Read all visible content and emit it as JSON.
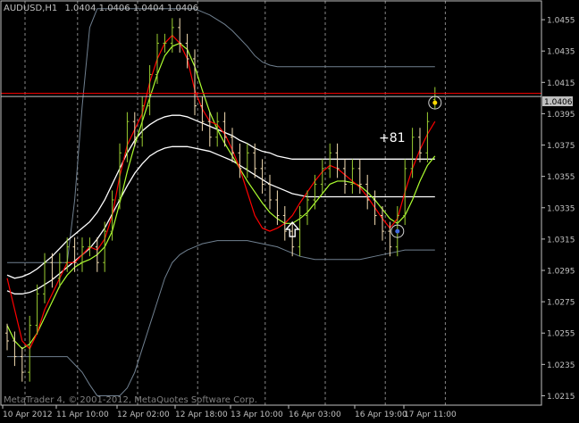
{
  "header": {
    "symbol_timeframe": "AUDUSD,H1",
    "ohlc": "1.0404 1.0406 1.0404 1.0406"
  },
  "current_price_label": "1.0406",
  "profit_annotation": "+81",
  "watermark": "MetaTrader 4, © 2001-2012, MetaQuotes Software Corp.",
  "colors": {
    "background": "#000000",
    "frame": "#c0c0c0",
    "grid": "#c0c0c0",
    "text": "#c0c0c0",
    "bull_candle": "#9acd32",
    "bear_candle": "#f5deb3",
    "ma_fast": "#ff0000",
    "ma_slow": "#adff2f",
    "envelope": "#ffffff",
    "bollinger": "#708090",
    "price_line": "#ff0000",
    "bid_line": "#c0c0c0"
  },
  "icons": [
    "up-arrow-icon",
    "entry-circle-icon",
    "exit-circle-icon"
  ],
  "chart_data": {
    "type": "candlestick",
    "symbol": "AUDUSD",
    "timeframe": "H1",
    "y_ticks": [
      "1.0455",
      "1.0435",
      "1.0415",
      "1.0395",
      "1.0375",
      "1.0355",
      "1.0335",
      "1.0315",
      "1.0295",
      "1.0275",
      "1.0255",
      "1.0235",
      "1.0215"
    ],
    "ylim": [
      1.0209,
      1.0467
    ],
    "x_ticks": [
      "10 Apr 2012",
      "11 Apr 10:00",
      "12 Apr 02:00",
      "12 Apr 18:00",
      "13 Apr 10:00",
      "16 Apr 03:00",
      "16 Apr 19:00",
      "17 Apr 11:00"
    ],
    "horizontal_lines": [
      {
        "name": "red-level",
        "value": 1.0408
      },
      {
        "name": "bid-level",
        "value": 1.0406
      }
    ],
    "close": [
      1.025,
      1.024,
      1.023,
      1.026,
      1.028,
      1.03,
      1.029,
      1.03,
      1.031,
      1.03,
      1.031,
      1.031,
      1.03,
      1.032,
      1.034,
      1.037,
      1.039,
      1.038,
      1.04,
      1.042,
      1.044,
      1.044,
      1.045,
      1.044,
      1.043,
      1.04,
      1.039,
      1.038,
      1.039,
      1.038,
      1.037,
      1.036,
      1.037,
      1.036,
      1.035,
      1.034,
      1.033,
      1.032,
      1.031,
      1.033,
      1.034,
      1.035,
      1.036,
      1.037,
      1.036,
      1.035,
      1.036,
      1.035,
      1.034,
      1.033,
      1.032,
      1.031,
      1.033,
      1.036,
      1.038,
      1.037,
      1.039,
      1.0406
    ],
    "open": [
      1.0255,
      1.025,
      1.024,
      1.023,
      1.026,
      1.028,
      1.03,
      1.029,
      1.03,
      1.031,
      1.03,
      1.031,
      1.031,
      1.03,
      1.032,
      1.034,
      1.037,
      1.039,
      1.038,
      1.04,
      1.042,
      1.044,
      1.044,
      1.045,
      1.044,
      1.043,
      1.04,
      1.039,
      1.038,
      1.039,
      1.038,
      1.037,
      1.036,
      1.037,
      1.036,
      1.035,
      1.034,
      1.033,
      1.032,
      1.031,
      1.033,
      1.034,
      1.035,
      1.036,
      1.037,
      1.036,
      1.035,
      1.036,
      1.035,
      1.034,
      1.033,
      1.032,
      1.031,
      1.033,
      1.036,
      1.038,
      1.037,
      1.0404
    ],
    "ma_fast": [
      1.029,
      1.027,
      1.025,
      1.0245,
      1.0255,
      1.027,
      1.028,
      1.029,
      1.03,
      1.03,
      1.0305,
      1.031,
      1.0308,
      1.0315,
      1.033,
      1.0355,
      1.0375,
      1.0385,
      1.0395,
      1.0415,
      1.043,
      1.044,
      1.0445,
      1.044,
      1.043,
      1.041,
      1.0398,
      1.039,
      1.0388,
      1.0382,
      1.0372,
      1.036,
      1.0345,
      1.033,
      1.0322,
      1.032,
      1.0322,
      1.0325,
      1.033,
      1.0338,
      1.0345,
      1.0352,
      1.0358,
      1.0362,
      1.036,
      1.0356,
      1.0352,
      1.0348,
      1.0342,
      1.0335,
      1.0328,
      1.0322,
      1.0328,
      1.0345,
      1.036,
      1.0372,
      1.0382,
      1.039
    ],
    "ma_slow": [
      1.026,
      1.025,
      1.0245,
      1.0248,
      1.0255,
      1.0265,
      1.0275,
      1.0285,
      1.0292,
      1.0297,
      1.03,
      1.0302,
      1.0305,
      1.031,
      1.032,
      1.0338,
      1.0358,
      1.0375,
      1.039,
      1.0405,
      1.042,
      1.0432,
      1.0438,
      1.044,
      1.0436,
      1.0425,
      1.041,
      1.0396,
      1.0385,
      1.0376,
      1.0368,
      1.036,
      1.0352,
      1.0345,
      1.0338,
      1.0332,
      1.0328,
      1.0325,
      1.0325,
      1.0328,
      1.0332,
      1.0338,
      1.0344,
      1.035,
      1.0352,
      1.0352,
      1.0351,
      1.0349,
      1.0345,
      1.034,
      1.0334,
      1.0328,
      1.0325,
      1.033,
      1.034,
      1.0352,
      1.0362,
      1.0368
    ],
    "envelope_upper": [
      1.0292,
      1.029,
      1.0291,
      1.0293,
      1.0296,
      1.03,
      1.0304,
      1.0309,
      1.0314,
      1.0318,
      1.0322,
      1.0326,
      1.0332,
      1.034,
      1.035,
      1.036,
      1.037,
      1.0378,
      1.0384,
      1.0388,
      1.0391,
      1.0393,
      1.0394,
      1.0394,
      1.0393,
      1.0391,
      1.0389,
      1.0387,
      1.0385,
      1.0383,
      1.0381,
      1.0378,
      1.0376,
      1.0373,
      1.0371,
      1.037,
      1.0368,
      1.0367,
      1.0366,
      1.0366,
      1.0366,
      1.0366,
      1.0366,
      1.0366,
      1.0366,
      1.0366,
      1.0366,
      1.0366,
      1.0366,
      1.0366,
      1.0366,
      1.0366,
      1.0366,
      1.0366,
      1.0366,
      1.0366,
      1.0366,
      1.0366
    ],
    "envelope_lower": [
      1.0282,
      1.028,
      1.028,
      1.0281,
      1.0283,
      1.0286,
      1.0289,
      1.0293,
      1.0297,
      1.0301,
      1.0305,
      1.0309,
      1.0315,
      1.0322,
      1.0331,
      1.034,
      1.0349,
      1.0357,
      1.0363,
      1.0368,
      1.0371,
      1.0373,
      1.0374,
      1.0374,
      1.0374,
      1.0373,
      1.0372,
      1.0371,
      1.0369,
      1.0367,
      1.0365,
      1.0362,
      1.0359,
      1.0356,
      1.0353,
      1.035,
      1.0348,
      1.0346,
      1.0344,
      1.0343,
      1.0342,
      1.0342,
      1.0342,
      1.0342,
      1.0342,
      1.0342,
      1.0342,
      1.0342,
      1.0342,
      1.0342,
      1.0342,
      1.0342,
      1.0342,
      1.0342,
      1.0342,
      1.0342,
      1.0342,
      1.0342
    ],
    "bollinger_upper": [
      1.03,
      1.03,
      1.03,
      1.03,
      1.03,
      1.03,
      1.03,
      1.03,
      1.03,
      1.034,
      1.04,
      1.045,
      1.0462,
      1.0462,
      1.0462,
      1.0462,
      1.0462,
      1.0462,
      1.0462,
      1.0462,
      1.0462,
      1.0462,
      1.0462,
      1.0462,
      1.0462,
      1.0462,
      1.046,
      1.0458,
      1.0455,
      1.0452,
      1.0448,
      1.0443,
      1.0438,
      1.0432,
      1.0428,
      1.0426,
      1.0425,
      1.0425,
      1.0425,
      1.0425,
      1.0425,
      1.0425,
      1.0425,
      1.0425,
      1.0425,
      1.0425,
      1.0425,
      1.0425,
      1.0425,
      1.0425,
      1.0425,
      1.0425,
      1.0425,
      1.0425,
      1.0425,
      1.0425,
      1.0425,
      1.0425
    ],
    "bollinger_lower": [
      1.024,
      1.024,
      1.024,
      1.024,
      1.024,
      1.024,
      1.024,
      1.024,
      1.024,
      1.0235,
      1.023,
      1.0222,
      1.0215,
      1.0215,
      1.0215,
      1.0215,
      1.022,
      1.023,
      1.0245,
      1.026,
      1.0275,
      1.029,
      1.03,
      1.0305,
      1.0308,
      1.031,
      1.0312,
      1.0313,
      1.0314,
      1.0314,
      1.0314,
      1.0314,
      1.0314,
      1.0313,
      1.0312,
      1.0311,
      1.031,
      1.0308,
      1.0306,
      1.0304,
      1.0303,
      1.0302,
      1.0302,
      1.0302,
      1.0302,
      1.0302,
      1.0302,
      1.0302,
      1.0303,
      1.0304,
      1.0305,
      1.0306,
      1.0307,
      1.0308,
      1.0308,
      1.0308,
      1.0308,
      1.0308
    ],
    "markers": [
      {
        "type": "buy-arrow",
        "bar": 38,
        "price": 1.032
      },
      {
        "type": "entry-circle",
        "bar": 52,
        "price": 1.032
      },
      {
        "type": "exit-circle",
        "bar": 57,
        "price": 1.0402
      }
    ]
  }
}
